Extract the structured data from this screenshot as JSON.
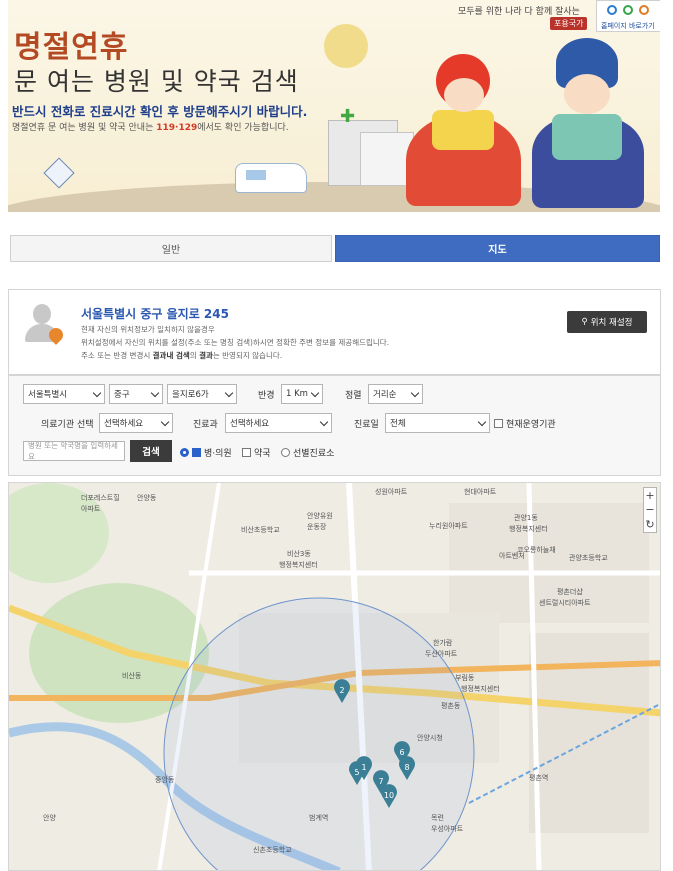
{
  "banner": {
    "title_line1": "명절연휴",
    "title_line2": "문 여는 병원 및 약국 검색",
    "notice": "반드시 전화로 진료시간 확인 후 방문해주시기 바랍니다.",
    "sub_prefix": "명절연휴 문 여는 병원 및 약국 안내는 ",
    "sub_numbers": "119·129",
    "sub_suffix": "에서도 확인 가능합니다.",
    "tagline": "모두를 위한 나라 다 함께 잘사는",
    "brand": "포용국가",
    "logo_text": "홈페이지 바로가기"
  },
  "tabs": {
    "general": "일반",
    "map": "지도"
  },
  "location": {
    "address": "서울특별시 중구 을지로 245",
    "note1": "현재 자신의 위치정보가 일치하지 않을경우",
    "note2": "위치설정에서 자신의 위치를 설정(주소 또는 명칭 검색)하시면 정확한 주변 정보를 제공해드립니다.",
    "note3_a": "주소 또는 반경 변경시 ",
    "note3_b": "결과내 검색",
    "note3_c": "의 ",
    "note3_d": "결과",
    "note3_e": "는 반영되지 않습니다.",
    "relocate_label": "위치 재설정"
  },
  "filter": {
    "city": "서울특별시",
    "district": "중구",
    "dong": "을지로6가",
    "radius_label": "반경",
    "radius": "1 Km",
    "sort_label": "정렬",
    "sort": "거리순",
    "facility_label": "의료기관 선택",
    "facility": "선택하세요",
    "dept_label": "진료과",
    "dept": "선택하세요",
    "day_label": "진료일",
    "day": "전체",
    "open_now_label": "현재운영기관",
    "search_placeholder": "병원 또는 약국명을 입력하세요",
    "search_button": "검색",
    "opt_hospital": "병·의원",
    "opt_pharmacy": "약국",
    "opt_selective": "선별진료소"
  },
  "map": {
    "labels": [
      "성원아파트",
      "현대아파트",
      "더포레스트힐",
      "안양동",
      "아파트",
      "관양1동",
      "행정복지센터",
      "비산초등학교",
      "비산3동",
      "행정복지센터",
      "안양유원",
      "운동장",
      "누리원아파트",
      "아트벤처",
      "코오롱하늘채",
      "평촌더샵",
      "센트럴시티아파트",
      "관양초등학교",
      "안양시청",
      "부림동",
      "행정복지센터",
      "비산동",
      "평촌동",
      "한가람",
      "두산아파트",
      "목련",
      "우성아파트",
      "중앙동",
      "범계역",
      "안양",
      "신촌초등학교",
      "평촌역"
    ],
    "markers": [
      "2",
      "5",
      "1",
      "6",
      "8",
      "7",
      "10"
    ],
    "zoom_in": "+",
    "zoom_out": "−"
  },
  "colors": {
    "tab_active": "#3f6cc0",
    "title": "#b34a23",
    "notice": "#1f3f8c",
    "marker": "#3b7f96"
  }
}
